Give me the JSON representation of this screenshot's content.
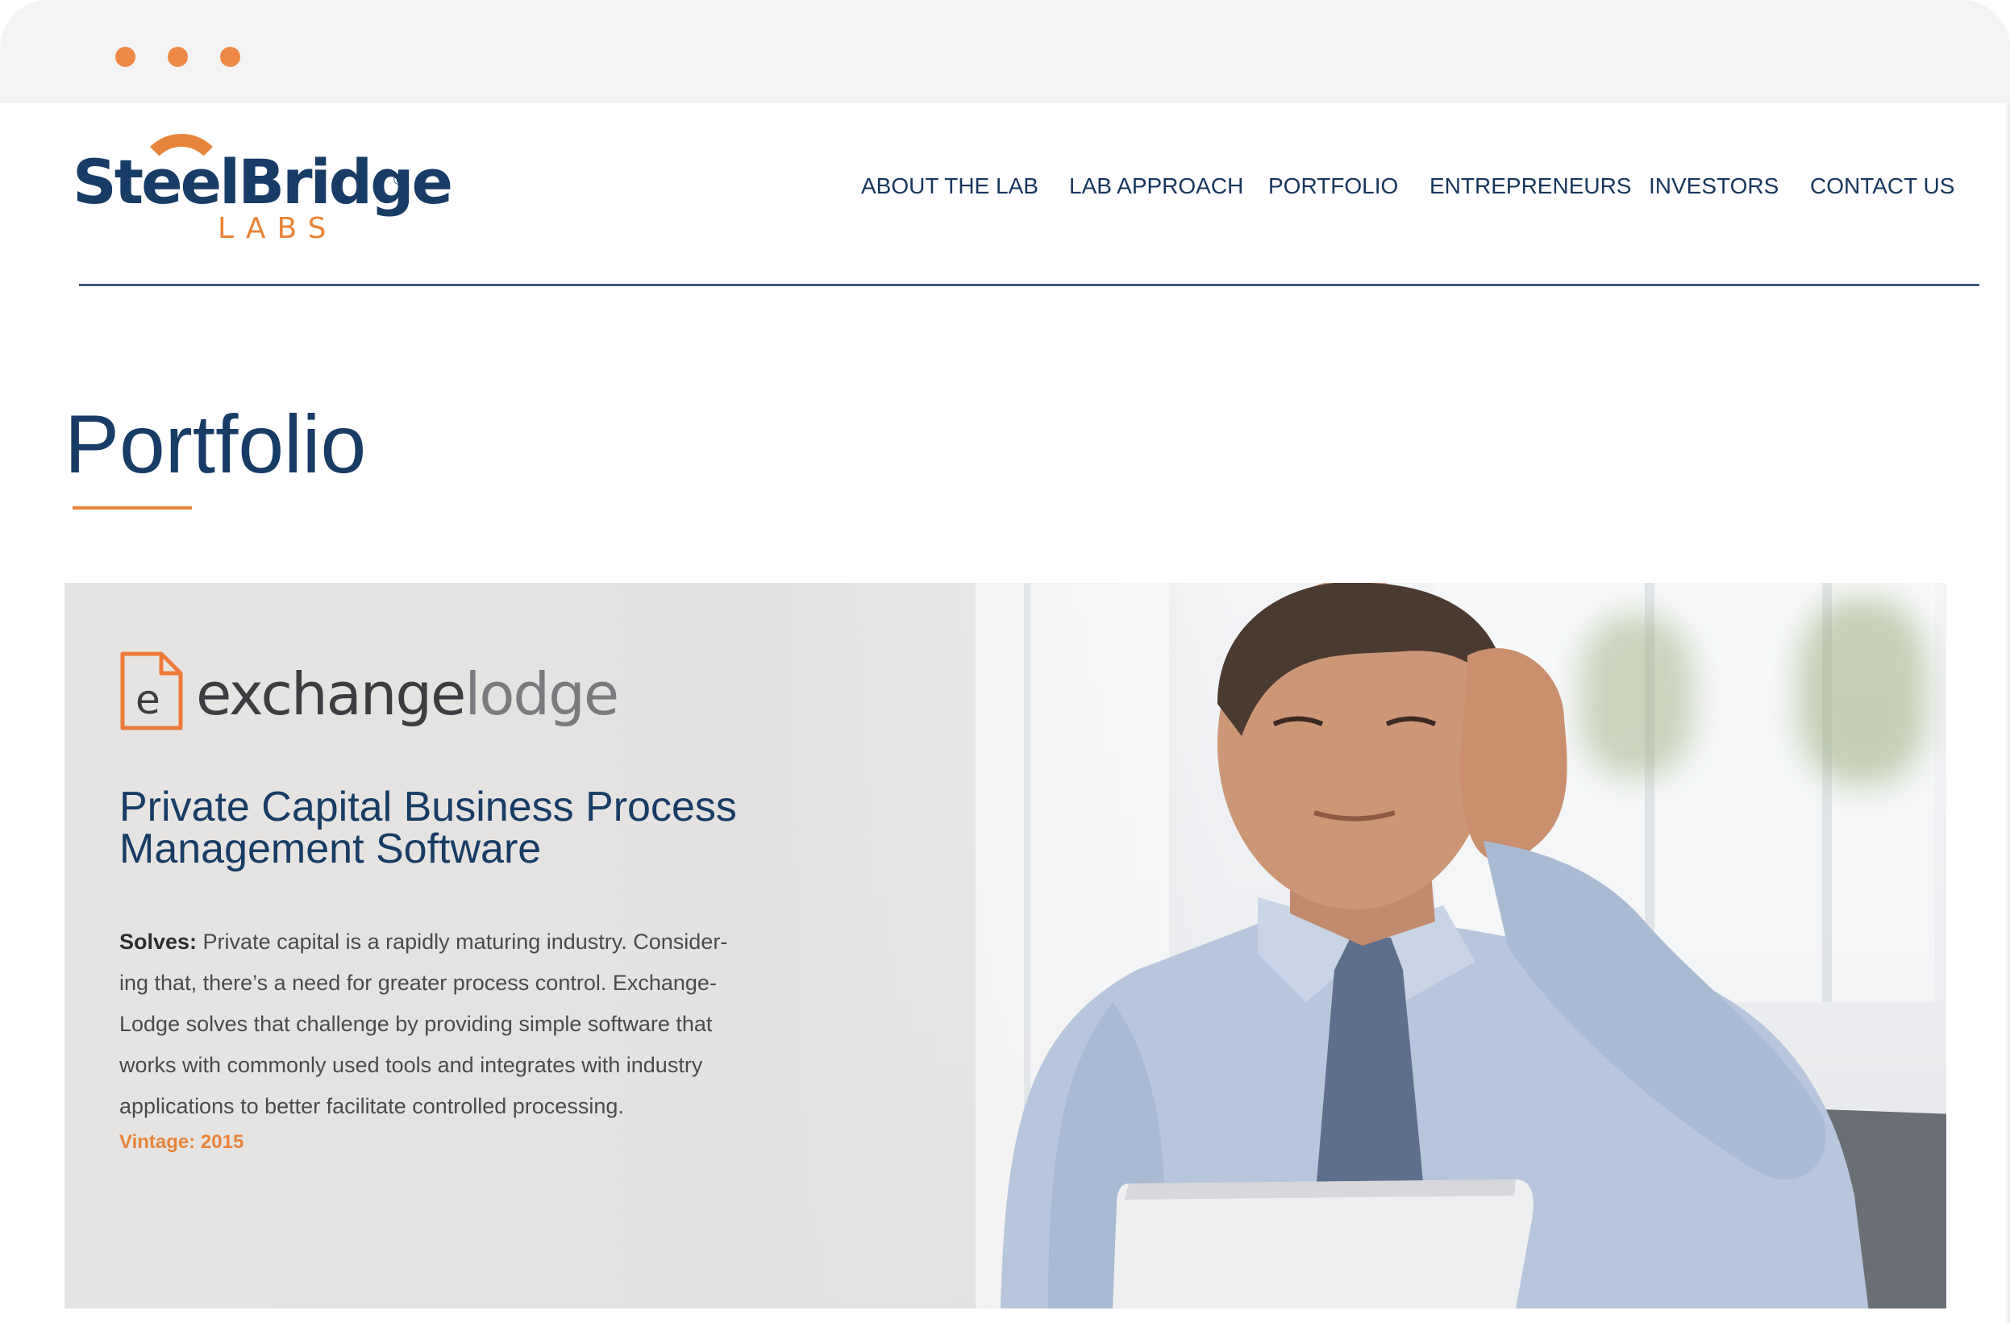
{
  "colors": {
    "window_dot": "#ef8745",
    "brand_navy": "#173c66",
    "brand_orange": "#e8843a",
    "nav_text": "#17365c",
    "rule": "#3c5a78",
    "body_text": "#4a4b4d",
    "vintage": "#e8843a"
  },
  "logo": {
    "word": "SteelBridge",
    "registered": "®",
    "sub": "LABS"
  },
  "nav": {
    "items": [
      {
        "label": "ABOUT THE LAB"
      },
      {
        "label": "LAB APPROACH"
      },
      {
        "label": "PORTFOLIO"
      },
      {
        "label": "ENTREPRENEURS"
      },
      {
        "label": "INVESTORS"
      },
      {
        "label": "CONTACT US"
      }
    ]
  },
  "page": {
    "title": "Portfolio"
  },
  "feature": {
    "logo_icon_letter": "e",
    "logo_word_dark": "exchange",
    "logo_word_light": "lodge",
    "heading": "Private Capital Business Process Management Software",
    "body_label": "Solves:",
    "body_text": " Private capital is a rapidly maturing industry. Consider-ing that, there’s a need for greater process control. Exchange-Lodge solves that challenge by providing simple software that works with commonly used tools and integrates with industry applications to better facilitate controlled processing.",
    "vintage": "Vintage: 2015"
  }
}
